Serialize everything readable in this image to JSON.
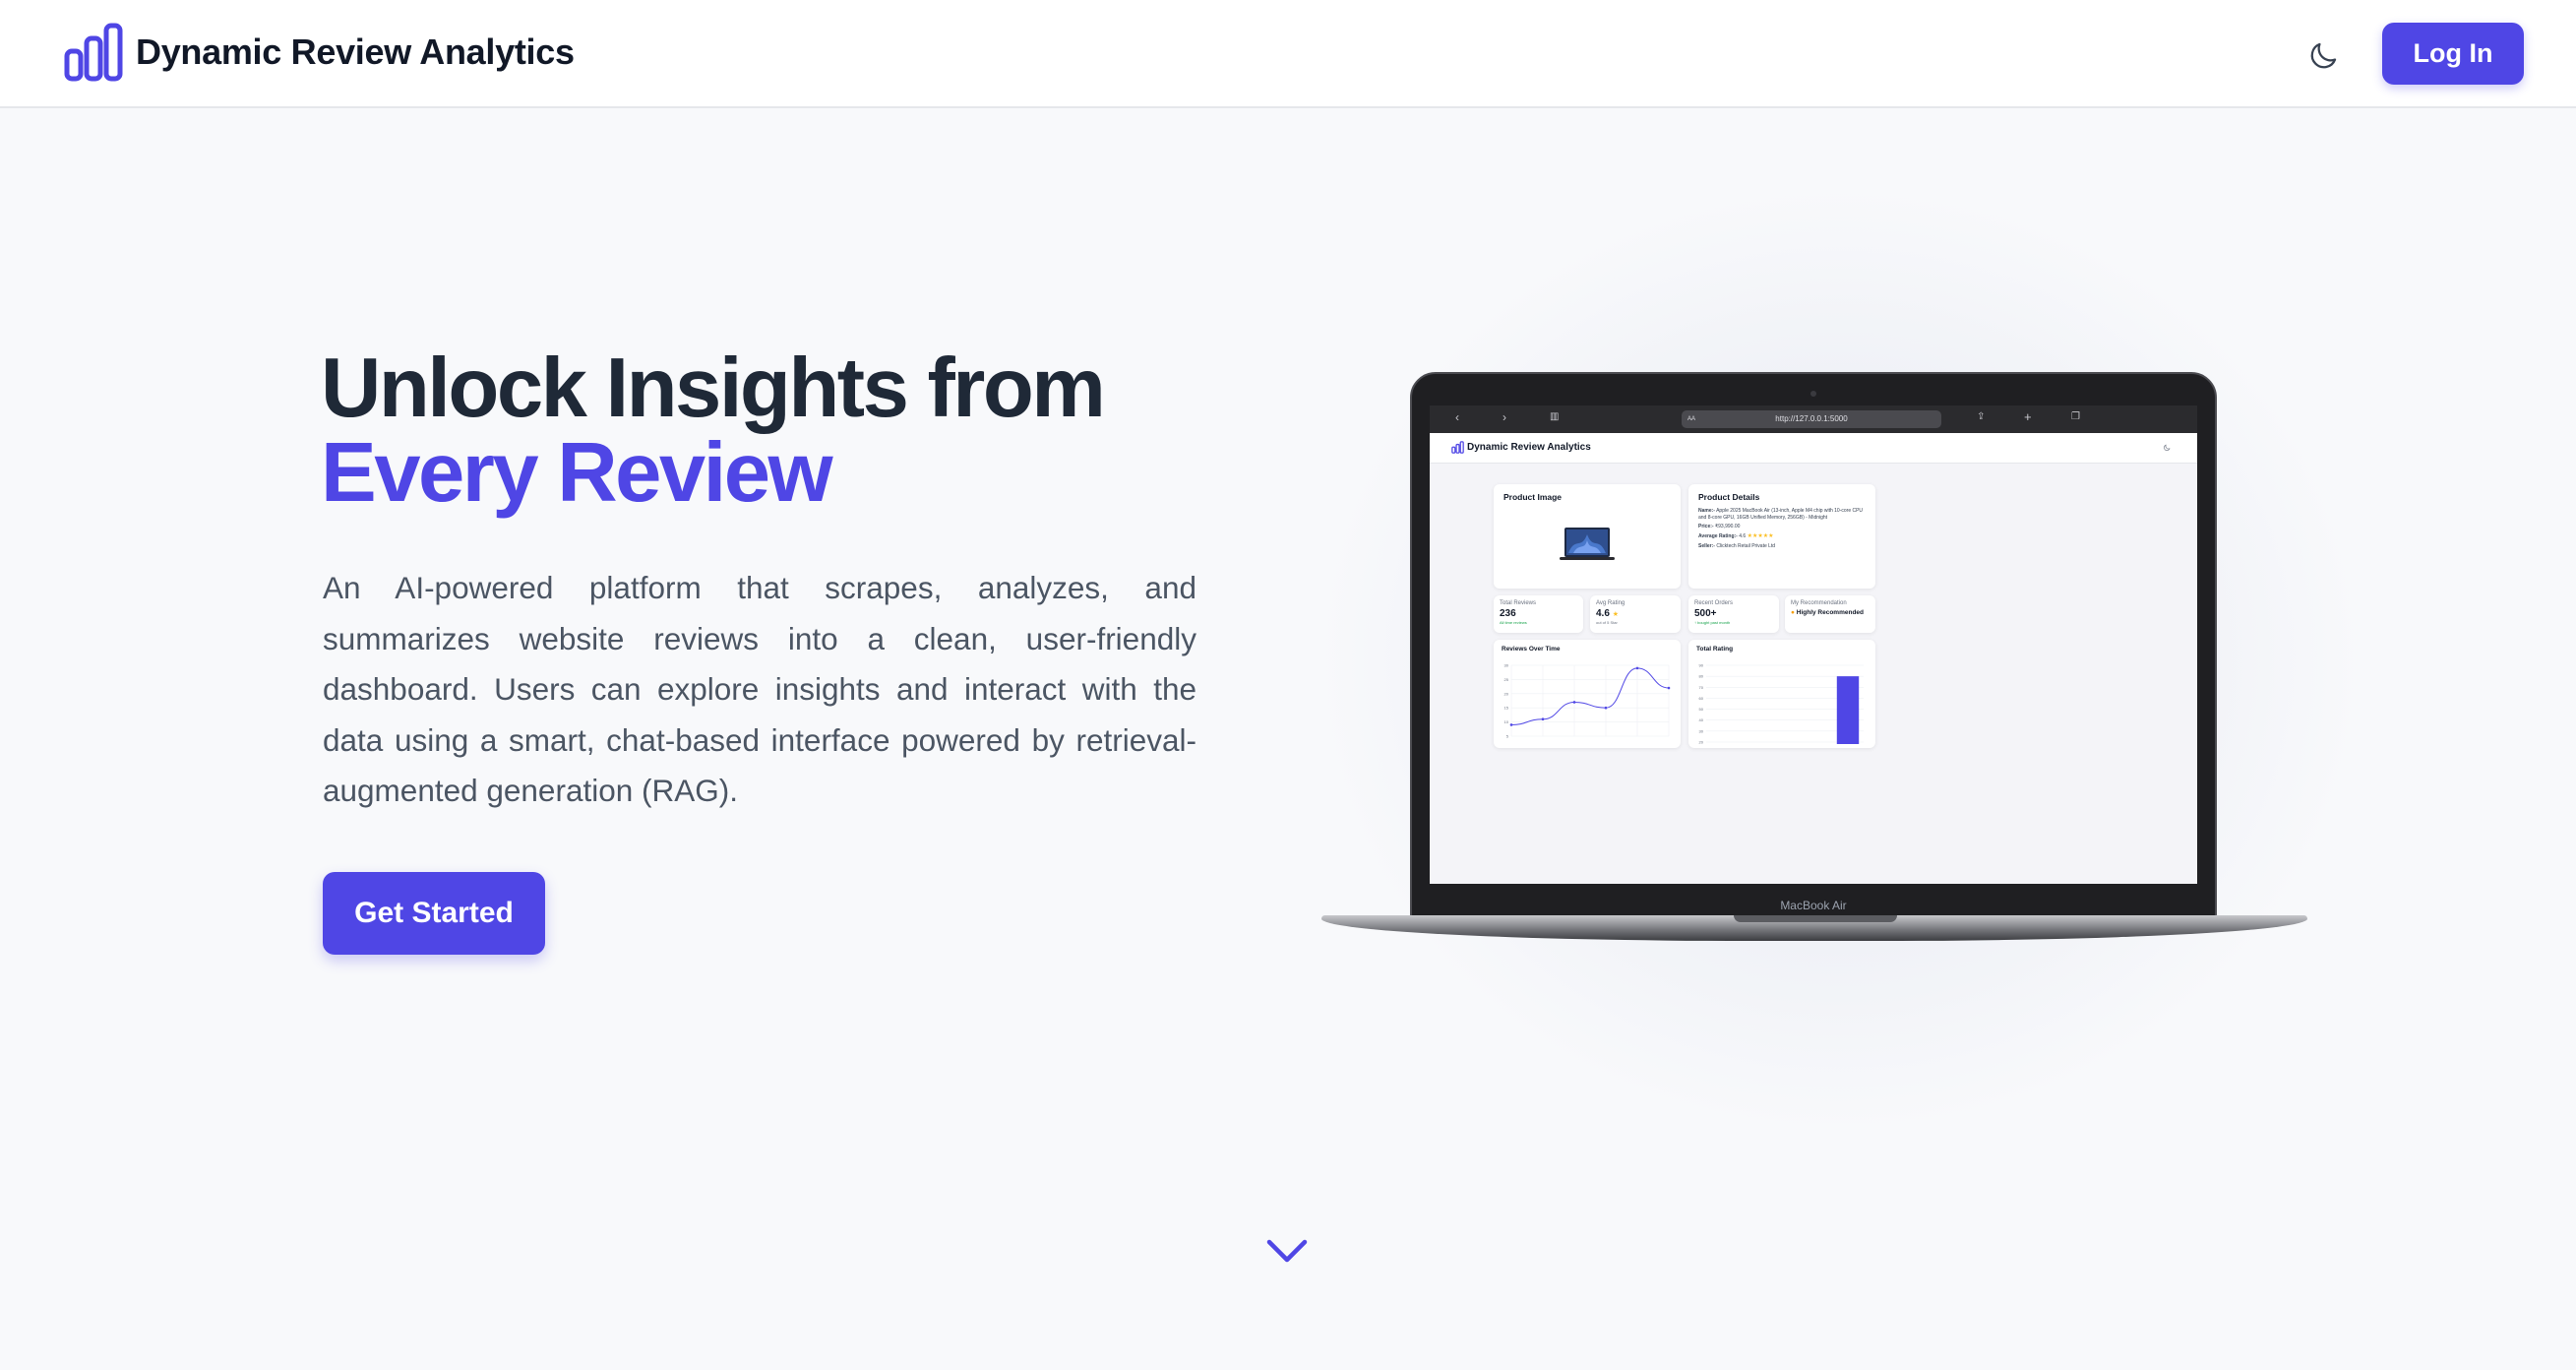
{
  "navbar": {
    "brand_name": "Dynamic Review Analytics",
    "brand_icon": "bar-chart-icon",
    "theme_icon": "moon-icon",
    "login_label": "Log In"
  },
  "hero": {
    "title_line1": "Unlock Insights from",
    "title_line2": "Every Review",
    "description": "An AI-powered platform that scrapes, analyzes, and summarizes website reviews into a clean, user-friendly dashboard. Users can explore insights and interact with the data using a smart, chat-based interface powered by retrieval-augmented generation (RAG).",
    "cta_label": "Get Started",
    "scroll_icon": "chevron-down-icon"
  },
  "laptop": {
    "model_label": "MacBook Air",
    "browser": {
      "url": "http://127.0.0.1:5000",
      "aa_label": "AA"
    },
    "dashboard": {
      "brand_name": "Dynamic Review Analytics",
      "product_image_title": "Product Image",
      "product_details_title": "Product Details",
      "name_label": "Name:-",
      "name_value": "Apple 2025 MacBook Air (13-inch, Apple M4 chip with 10-core CPU and 8-core GPU, 16GB Unified Memory, 256GB) - Midnight",
      "price_label": "Price:-",
      "price_value": "₹93,990.00",
      "avg_rating_label": "Average Rating:-",
      "avg_rating_value": "4.6",
      "stars": "★★★★★",
      "seller_label": "Seller:-",
      "seller_value": "Clicktech Retail Private Ltd",
      "stats": [
        {
          "label": "Total Reviews",
          "value": "236",
          "sub": "All time reviews"
        },
        {
          "label": "Avg Rating",
          "value": "4.6",
          "sub": "out of 5 Star"
        },
        {
          "label": "Recent Orders",
          "value": "500+",
          "sub": "↑ bought past month"
        },
        {
          "label": "My Recommendation",
          "value": "Highly Recommended",
          "sub": ""
        }
      ],
      "reviews_chart": {
        "title": "Reviews Over Time",
        "y_ticks": [
          "30",
          "25",
          "20",
          "15",
          "10",
          "5"
        ]
      },
      "rating_chart": {
        "title": "Total Rating",
        "y_ticks": [
          "90",
          "80",
          "70",
          "60",
          "50",
          "40",
          "30",
          "20"
        ]
      }
    }
  },
  "chart_data": [
    {
      "type": "line",
      "title": "Reviews Over Time",
      "x": [
        1,
        2,
        3,
        4,
        5,
        6
      ],
      "values": [
        9,
        11,
        17,
        15,
        29,
        22
      ],
      "ylim": [
        5,
        30
      ],
      "color": "#4f46e5"
    },
    {
      "type": "bar",
      "title": "Total Rating",
      "values": [
        0,
        0,
        0,
        0,
        80
      ],
      "ylim": [
        20,
        90
      ],
      "color": "#4f46e5"
    }
  ],
  "colors": {
    "accent": "#4f46e5",
    "text_dark": "#1f2937",
    "text_muted": "#4b5563",
    "background": "#f8f9fb"
  }
}
